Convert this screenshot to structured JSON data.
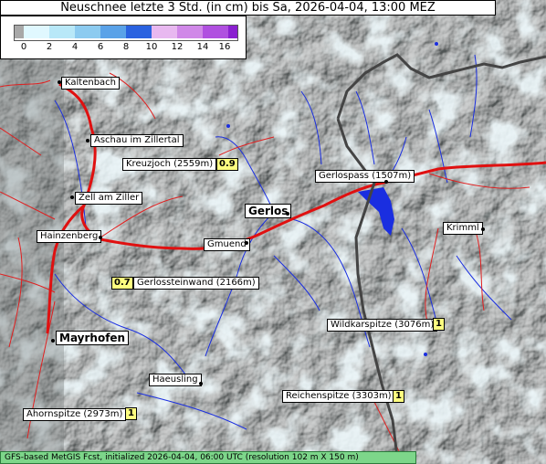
{
  "title": "Neuschnee letzte 3 Std. (in cm) bis Sa, 2026-04-04, 13:00 MEZ",
  "legend": {
    "ticks": [
      "0",
      "2",
      "4",
      "6",
      "8",
      "10",
      "12",
      "14",
      "16"
    ],
    "colors": [
      "#a8a8a8",
      "#e0f8ff",
      "#b8e8f8",
      "#8ccbf0",
      "#5aa2e8",
      "#2a62e0",
      "#e8b8f0",
      "#d088e8",
      "#b050e0",
      "#8a20d0"
    ]
  },
  "places": {
    "kaltenbach": "Kaltenbach",
    "aschau": "Aschau im Zillertal",
    "kreuzjoch": "Kreuzjoch (2559m)",
    "kreuzjoch_val": "0.9",
    "zell": "Zell am Ziller",
    "gerlos": "Gerlos",
    "gerlospass": "Gerlospass (1507m)",
    "hainzenberg": "Hainzenberg",
    "gmuend": "Gmuend",
    "krimml": "Krimml",
    "gerlossteinwand_val": "0.7",
    "gerlossteinwand": "Gerlossteinwand (2166m)",
    "wildkarspitze": "Wildkarspitze (3076m)",
    "wildkarspitze_val": "1",
    "mayrhofen": "Mayrhofen",
    "haeusling": "Haeusling",
    "reichenspitze": "Reichenspitze (3303m)",
    "reichenspitze_val": "1",
    "ahornspitze": "Ahornspitze (2973m)",
    "ahornspitze_val": "1"
  },
  "footer": "GFS-based MetGIS Fcst, initialized 2026-04-04, 06:00 UTC  (resolution 102 m X 150 m)"
}
